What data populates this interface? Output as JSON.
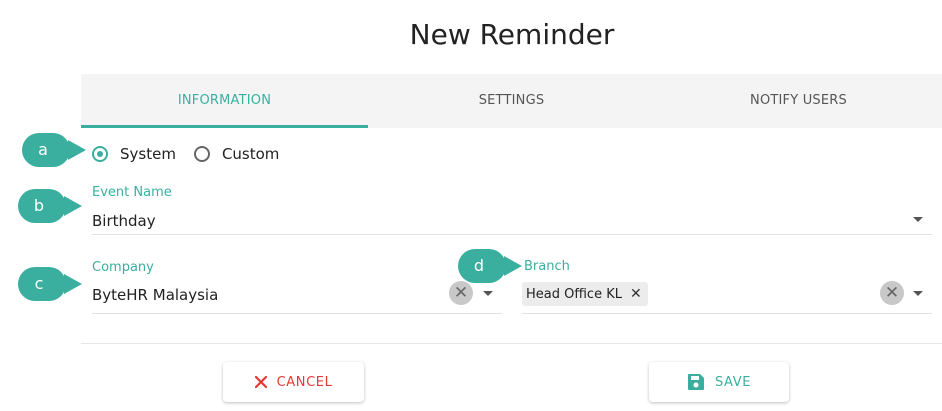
{
  "title": "New Reminder",
  "tabs": [
    {
      "label": "INFORMATION",
      "active": true
    },
    {
      "label": "SETTINGS",
      "active": false
    },
    {
      "label": "NOTIFY USERS",
      "active": false
    }
  ],
  "markers": [
    "a",
    "b",
    "c",
    "d"
  ],
  "event_type": {
    "options": [
      "System",
      "Custom"
    ],
    "selected": "System"
  },
  "event_name": {
    "label": "Event Name",
    "value": "Birthday"
  },
  "company": {
    "label": "Company",
    "value": "ByteHR Malaysia"
  },
  "branch": {
    "label": "Branch",
    "chips": [
      "Head Office KL"
    ]
  },
  "actions": {
    "cancel_label": "CANCEL",
    "save_label": "SAVE"
  },
  "colors": {
    "accent": "#3aaf9f",
    "cancel": "#e53935",
    "marker": "#3aaf9f"
  },
  "icons": {
    "cancel": "close-icon",
    "save": "floppy-disk-icon",
    "clear": "clear-icon",
    "dropdown": "chevron-down-icon",
    "chip_remove": "chip-remove-icon"
  }
}
